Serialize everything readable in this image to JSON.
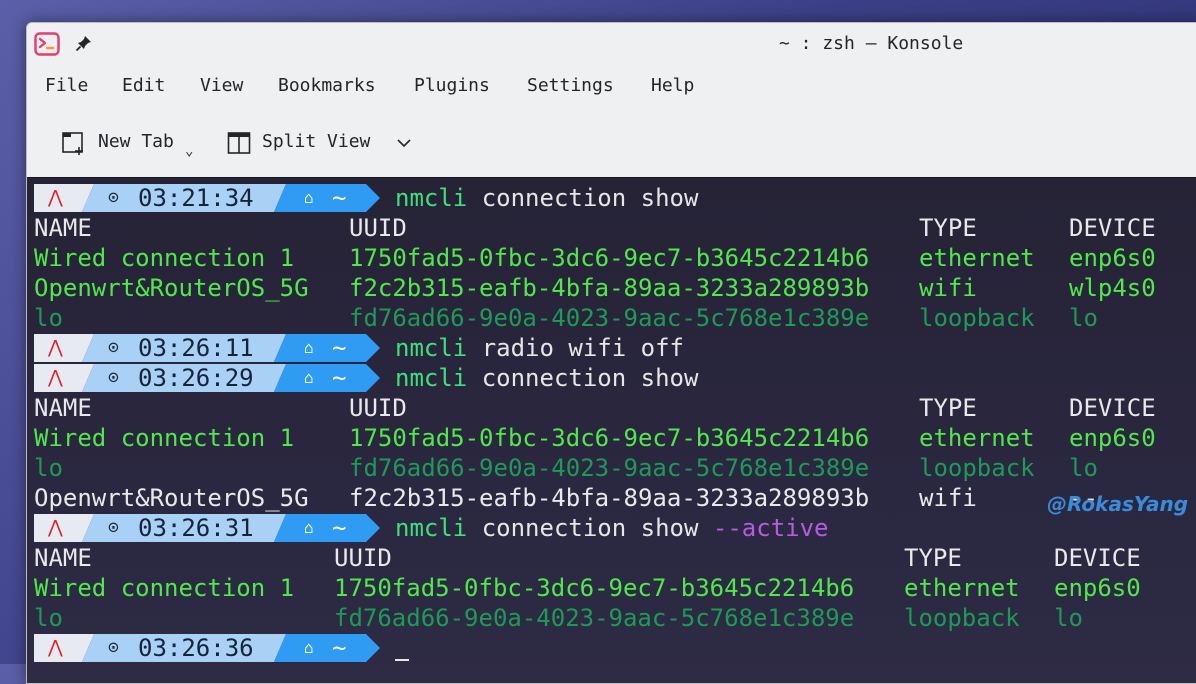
{
  "window": {
    "title": "~ : zsh — Konsole",
    "accent": "#e93a6e"
  },
  "menubar": {
    "items": [
      "File",
      "Edit",
      "View",
      "Bookmarks",
      "Plugins",
      "Settings",
      "Help"
    ]
  },
  "toolbar": {
    "new_tab_label": "New Tab",
    "split_view_label": "Split View"
  },
  "prompt": {
    "home_glyph": "~",
    "colors": {
      "arch": "#e8eaf2",
      "clock": "#a9d0f5",
      "dir": "#2f9bf2"
    }
  },
  "terminal": {
    "blocks": [
      {
        "time": "03:21:34",
        "command": {
          "bin": "nmcli",
          "args": "connection show",
          "flag": ""
        },
        "header": [
          "NAME",
          "UUID",
          "TYPE",
          "DEVICE"
        ],
        "rows": [
          {
            "cells": [
              "Wired connection 1",
              "1750fad5-0fbc-3dc6-9ec7-b3645c2214b6",
              "ethernet",
              "enp6s0"
            ],
            "style": "g"
          },
          {
            "cells": [
              "Openwrt&RouterOS_5G",
              "f2c2b315-eafb-4bfa-89aa-3233a289893b",
              "wifi",
              "wlp4s0"
            ],
            "style": "g"
          },
          {
            "cells": [
              "lo",
              "fd76ad66-9e0a-4023-9aac-5c768e1c389e",
              "loopback",
              "lo"
            ],
            "style": "dim"
          }
        ]
      },
      {
        "time": "03:26:11",
        "command": {
          "bin": "nmcli",
          "args": "radio wifi off",
          "flag": ""
        },
        "header": [],
        "rows": []
      },
      {
        "time": "03:26:29",
        "command": {
          "bin": "nmcli",
          "args": "connection show",
          "flag": ""
        },
        "header": [
          "NAME",
          "UUID",
          "TYPE",
          "DEVICE"
        ],
        "rows": [
          {
            "cells": [
              "Wired connection 1",
              "1750fad5-0fbc-3dc6-9ec7-b3645c2214b6",
              "ethernet",
              "enp6s0"
            ],
            "style": "g"
          },
          {
            "cells": [
              "lo",
              "fd76ad66-9e0a-4023-9aac-5c768e1c389e",
              "loopback",
              "lo"
            ],
            "style": "dim"
          },
          {
            "cells": [
              "Openwrt&RouterOS_5G",
              "f2c2b315-eafb-4bfa-89aa-3233a289893b",
              "wifi",
              "--"
            ],
            "style": "hdr"
          }
        ]
      },
      {
        "time": "03:26:31",
        "command": {
          "bin": "nmcli",
          "args": "connection show",
          "flag": "--active"
        },
        "header": [
          "NAME",
          "UUID",
          "TYPE",
          "DEVICE"
        ],
        "rows": [
          {
            "cells": [
              "Wired connection 1",
              "1750fad5-0fbc-3dc6-9ec7-b3645c2214b6",
              "ethernet",
              "enp6s0"
            ],
            "style": "g"
          },
          {
            "cells": [
              "lo",
              "fd76ad66-9e0a-4023-9aac-5c768e1c389e",
              "loopback",
              "lo"
            ],
            "style": "dim"
          }
        ]
      },
      {
        "time": "03:26:36",
        "command": {
          "bin": "",
          "args": "",
          "flag": ""
        },
        "header": [],
        "rows": []
      }
    ]
  },
  "watermark": "@RokasYang"
}
